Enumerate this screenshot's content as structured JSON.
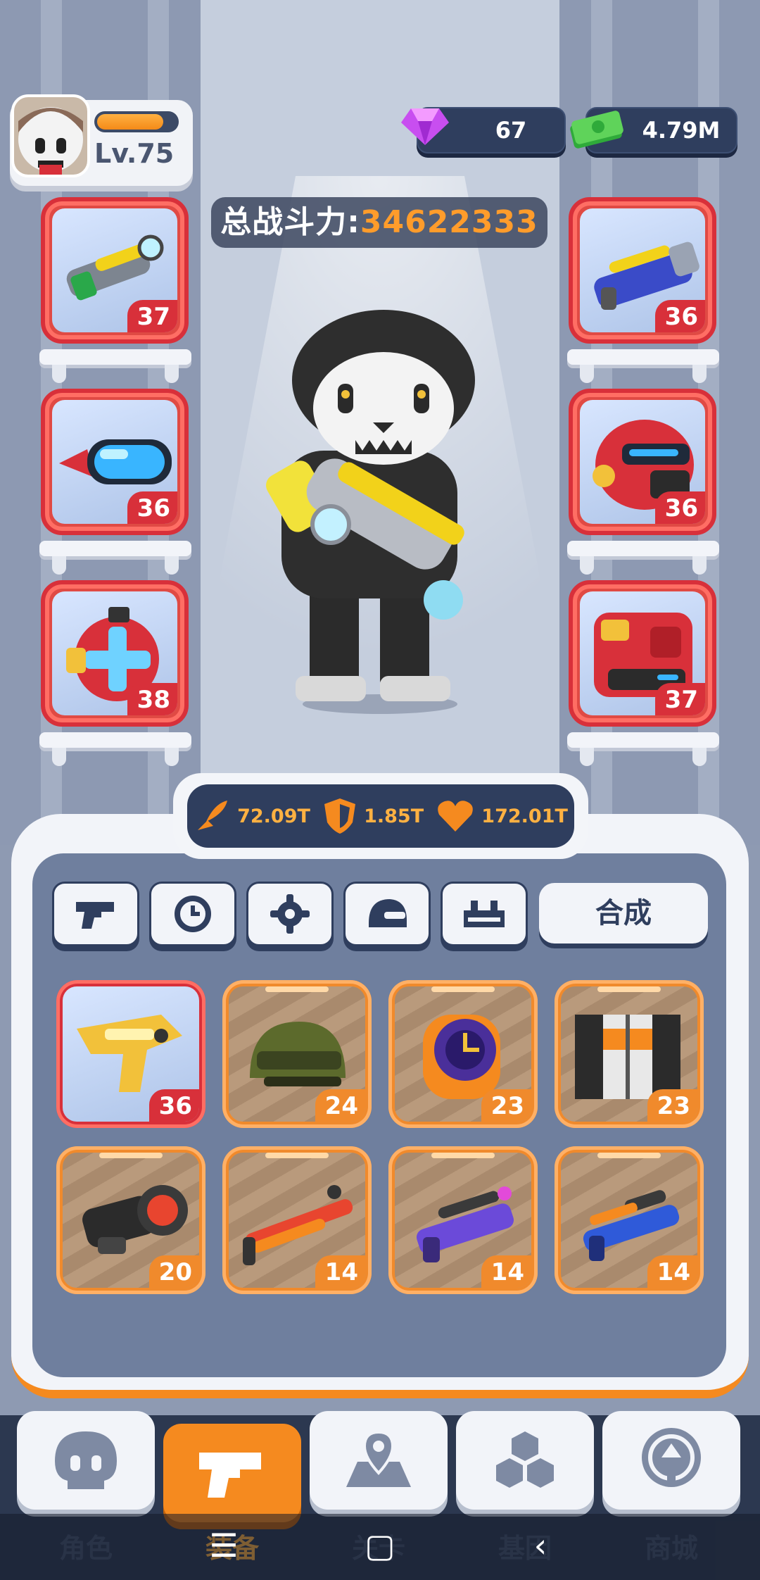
{
  "player": {
    "level": "Lv.75",
    "xp_fraction": 0.84
  },
  "currency": {
    "gems": "67",
    "cash": "4.79M"
  },
  "power": {
    "label": "总战斗力:",
    "value": "34622333"
  },
  "equipped_left": [
    {
      "name": "plasma-blaster",
      "level": "37"
    },
    {
      "name": "visor-goggles",
      "level": "36"
    },
    {
      "name": "medkit-shield",
      "level": "38"
    }
  ],
  "equipped_right": [
    {
      "name": "blue-launcher",
      "level": "36"
    },
    {
      "name": "red-helmet",
      "level": "36"
    },
    {
      "name": "red-armor",
      "level": "37"
    }
  ],
  "stats": {
    "attack": "72.09T",
    "defense": "1.85T",
    "health": "172.01T"
  },
  "tabs": [
    {
      "icon": "gun-icon"
    },
    {
      "icon": "watch-icon"
    },
    {
      "icon": "gear-icon"
    },
    {
      "icon": "helmet-icon"
    },
    {
      "icon": "armor-icon"
    }
  ],
  "compose_label": "合成",
  "inventory": [
    {
      "name": "golden-pistol",
      "level": "36",
      "rarity": "red"
    },
    {
      "name": "military-helmet",
      "level": "24",
      "rarity": "orange"
    },
    {
      "name": "purple-watch",
      "level": "23",
      "rarity": "orange"
    },
    {
      "name": "racing-jacket",
      "level": "23",
      "rarity": "orange"
    },
    {
      "name": "scope",
      "level": "20",
      "rarity": "orange"
    },
    {
      "name": "red-shotgun",
      "level": "14",
      "rarity": "orange"
    },
    {
      "name": "purple-rifle",
      "level": "14",
      "rarity": "orange"
    },
    {
      "name": "blue-rifle",
      "level": "14",
      "rarity": "orange"
    }
  ],
  "nav": [
    {
      "label": "角色",
      "icon": "skull-icon"
    },
    {
      "label": "装备",
      "icon": "gun-icon",
      "active": true
    },
    {
      "label": "关卡",
      "icon": "map-icon"
    },
    {
      "label": "基因",
      "icon": "hexagon-icon"
    },
    {
      "label": "商城",
      "icon": "shop-icon"
    }
  ],
  "colors": {
    "accent": "#f58a1f",
    "panel": "#2f3e5e",
    "legendary": "#d8303a",
    "epic": "#f08a2c"
  }
}
